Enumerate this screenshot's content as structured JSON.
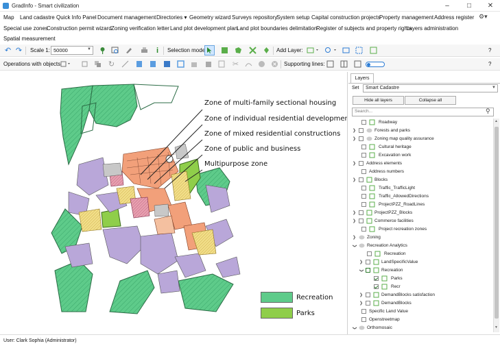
{
  "app": {
    "title": "GradInfo - Smart civilization"
  },
  "menu": {
    "row1": [
      "Map",
      "Land cadastre",
      "Quick Info Panel",
      "Document management",
      "Directories ▾",
      "Geometry wizard",
      "Surveys repository",
      "System setup",
      "Capital construction projects",
      "Property management",
      "Address register"
    ],
    "row2": [
      "Special use zones",
      "Construction permit wizard",
      "Zoning verification letter",
      "Land plot development plan",
      "Land plot boundaries delimitation",
      "Register of subjects and property rights",
      "Layers administration"
    ],
    "row3": [
      "Spatial measurement"
    ]
  },
  "toolbar1": {
    "scale_label": "Scale 1:",
    "scale_value": "50000",
    "selection_mode": "Selection mode",
    "add_layer": "Add Layer:",
    "help": "?"
  },
  "toolbar2": {
    "operations": "Operations with objects",
    "supporting_lines": "Supporting lines:",
    "help": "?"
  },
  "map": {
    "zone_labels": [
      "Zone of multi-family sectional housing",
      "Zone of individual residential development",
      "Zone of mixed residential constructions",
      "Zone of public and business",
      "Multipurpose zone"
    ],
    "legend": [
      {
        "label": "Recreation",
        "color": "#5ecb8a"
      },
      {
        "label": "Parks",
        "color": "#8fce4a"
      }
    ]
  },
  "panel": {
    "tab": "Layers",
    "set_label": "Set",
    "set_value": "Smart Cadastre",
    "hide_all": "Hide all layers",
    "collapse_all": "Collapse all",
    "search_placeholder": "Search...",
    "tree": [
      "Roadway",
      "Forests and parks",
      "Zoning map quality assurance",
      "Cultural heritage",
      "Excavation work",
      "Address elements",
      "Address numbers",
      "Blocks",
      "Traffic_TrafficLight",
      "Traffic_AllowedDirections",
      "ProjectPZZ_RoadLines",
      "ProjectPZZ_Blocks",
      "Commerce facilities",
      "Project recreation zones",
      "Zoning",
      "Recreation Analytics",
      "Recreation",
      "LandSpecificValue",
      "Recreation",
      "Parks",
      "Recr",
      "DemandBlocks satisfaction",
      "DemandBlocks",
      "Specific Land Value",
      "Openstreetmap",
      "Orthomosaic"
    ]
  },
  "status": {
    "user": "User: Clark Sophia  (Administrator)"
  }
}
